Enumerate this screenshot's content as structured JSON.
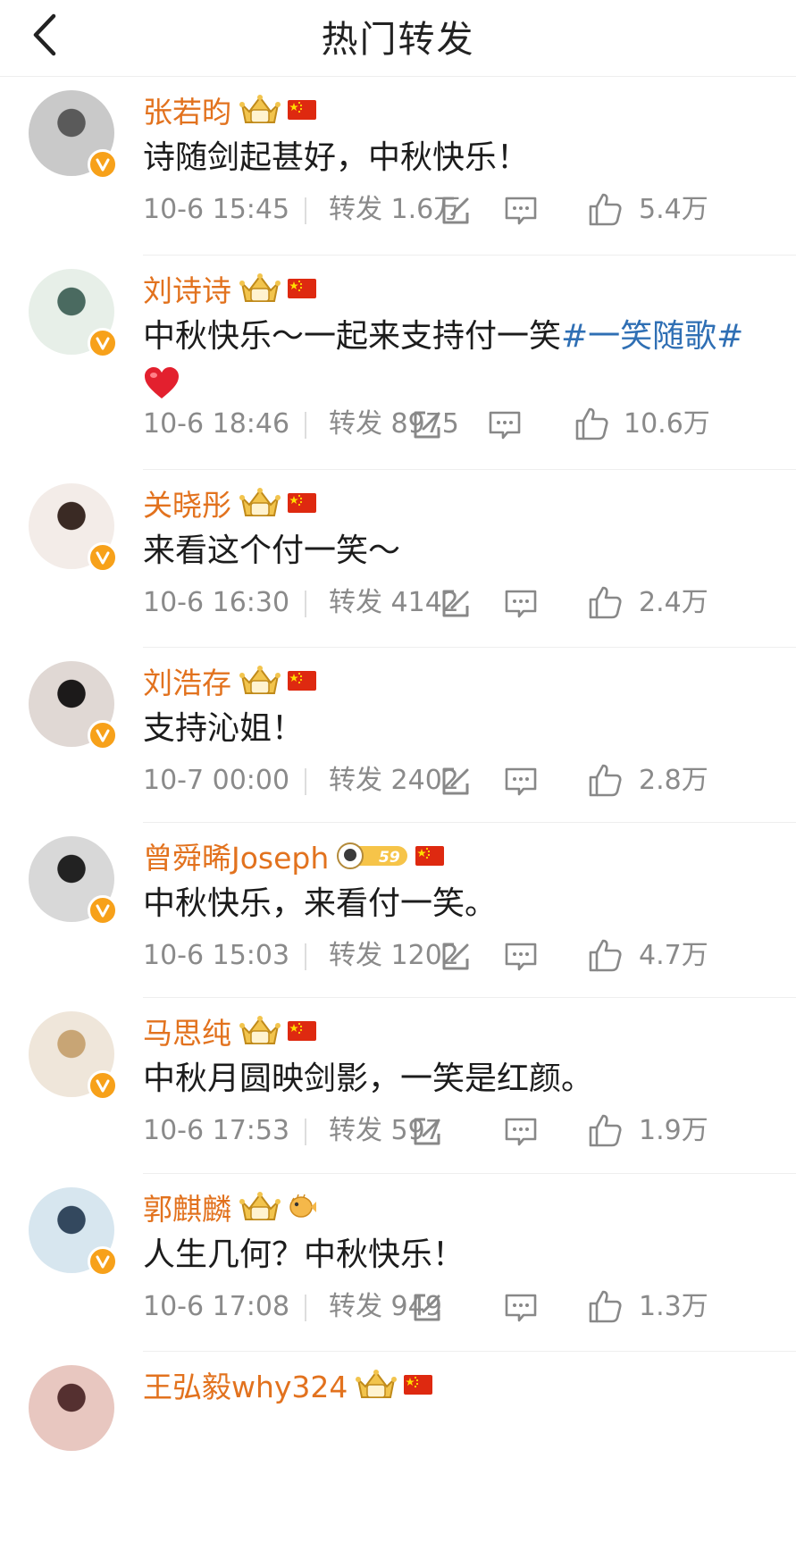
{
  "header": {
    "title": "热门转发"
  },
  "labels": {
    "repost": "转发"
  },
  "colors": {
    "username": "#e2721e",
    "hashtag": "#2f6fb4",
    "meta": "#8a8a8a",
    "verified": "#f7a11a"
  },
  "posts": [
    {
      "name": "张若昀",
      "badges": [
        "crown",
        "flag-cn"
      ],
      "text": "诗随剑起甚好，中秋快乐！",
      "time": "10-6 15:45",
      "reposts": "1.6万",
      "likes": "5.4万"
    },
    {
      "name": "刘诗诗",
      "badges": [
        "crown",
        "flag-cn"
      ],
      "text": "中秋快乐～一起来支持付一笑",
      "hashtag": "#一笑随歌#",
      "emoji": "red-heart",
      "time": "10-6 18:46",
      "reposts": "8975",
      "likes": "10.6万"
    },
    {
      "name": "关晓彤",
      "badges": [
        "crown",
        "flag-cn"
      ],
      "text": "来看这个付一笑～",
      "time": "10-6 16:30",
      "reposts": "4142",
      "likes": "2.4万"
    },
    {
      "name": "刘浩存",
      "badges": [
        "crown",
        "flag-cn"
      ],
      "text": "支持沁姐！",
      "time": "10-7 00:00",
      "reposts": "2402",
      "likes": "2.8万"
    },
    {
      "name": "曾舜晞Joseph",
      "badges": [
        "astronaut-level",
        "flag-cn"
      ],
      "level": "59",
      "text": "中秋快乐，来看付一笑。",
      "time": "10-6 15:03",
      "reposts": "1202",
      "likes": "4.7万"
    },
    {
      "name": "马思纯",
      "badges": [
        "crown",
        "flag-cn"
      ],
      "text": "中秋月圆映剑影，一笑是红颜。",
      "time": "10-6 17:53",
      "reposts": "597",
      "likes": "1.9万"
    },
    {
      "name": "郭麒麟",
      "badges": [
        "crown",
        "pufferfish"
      ],
      "text": "人生几何？中秋快乐！",
      "time": "10-6 17:08",
      "reposts": "949",
      "likes": "1.3万"
    },
    {
      "name": "王弘毅why324",
      "badges": [
        "crown",
        "flag-cn"
      ]
    }
  ]
}
